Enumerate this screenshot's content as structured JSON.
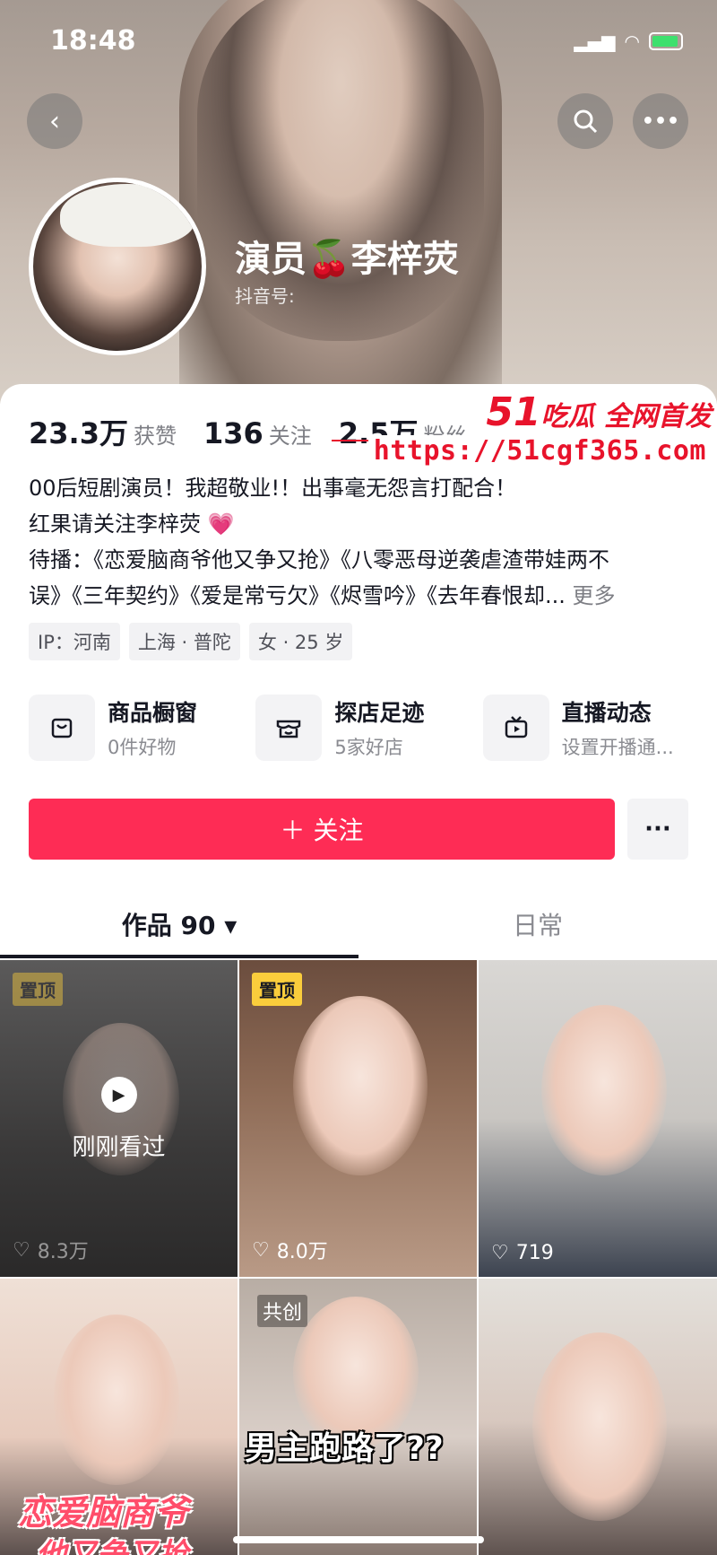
{
  "status_bar": {
    "time": "18:48"
  },
  "profile": {
    "name": "演员🍒李梓荧",
    "douyin_id_label": "抖音号:"
  },
  "stats": [
    {
      "value": "23.3万",
      "label": "获赞"
    },
    {
      "value": "136",
      "label": "关注"
    },
    {
      "value": "2.5万",
      "label": "粉丝"
    }
  ],
  "watermark": {
    "title": "吃瓜 全网首发",
    "title_num": "51",
    "url": "https://51cgf365.com"
  },
  "bio": {
    "line1": "00后短剧演员！我超敬业!！出事毫无怨言打配合！",
    "line2": "红果请关注李梓荧 💗",
    "line3": "待播：《恋爱脑商爷他又争又抢》《八零恶母逆袭虐渣带娃两不",
    "line4": "误》《三年契约》《爱是常亏欠》《烬雪吟》《去年春恨却...",
    "more": "更多"
  },
  "tags": [
    "IP：河南",
    "上海 · 普陀",
    "女 · 25 岁"
  ],
  "services": [
    {
      "title": "商品橱窗",
      "sub": "0件好物",
      "icon": "shopping-bag-icon"
    },
    {
      "title": "探店足迹",
      "sub": "5家好店",
      "icon": "store-icon"
    },
    {
      "title": "直播动态",
      "sub": "设置开播通...",
      "icon": "tv-icon"
    }
  ],
  "follow_label": "＋ 关注",
  "more_label": "···",
  "tabs": [
    {
      "label": "作品 90 ▾"
    },
    {
      "label": "日常"
    }
  ],
  "videos": [
    {
      "pin": "置顶",
      "likes": "8.3万",
      "watched": "刚刚看过"
    },
    {
      "pin": "置顶",
      "likes": "8.0万"
    },
    {
      "likes": "719"
    },
    {
      "overlay": "恋爱脑商爷",
      "overlay2": "他又争又抢"
    },
    {
      "badge": "共创",
      "overlay": "男主跑路了??"
    },
    {}
  ],
  "colors": {
    "follow": "#fe2c55",
    "pin": "#facd3c",
    "watermark": "#e8132b"
  }
}
